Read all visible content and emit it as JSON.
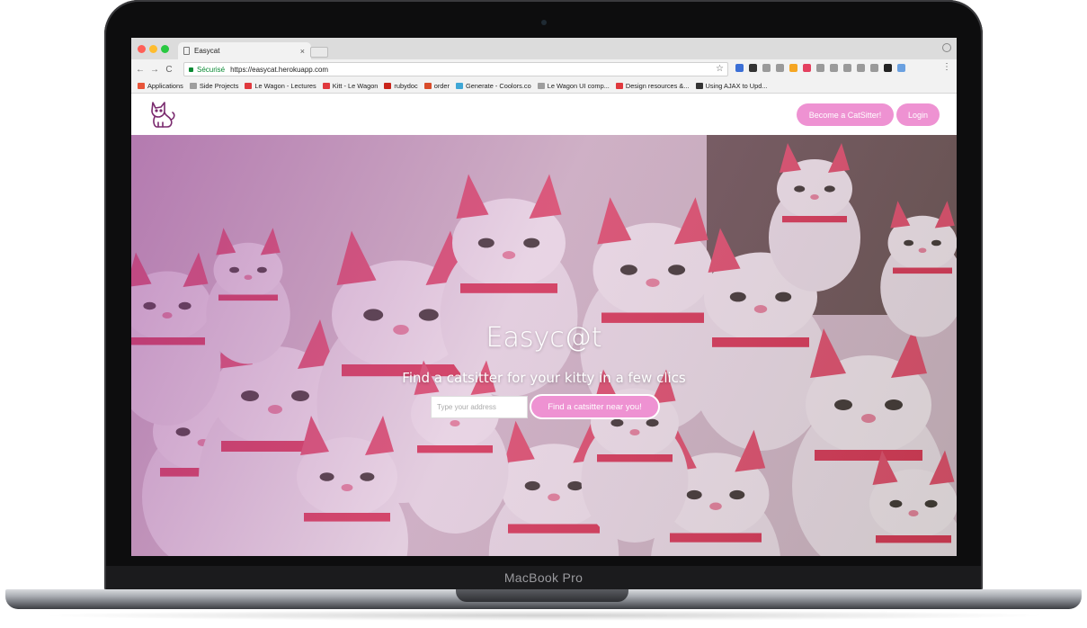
{
  "device": {
    "model_label": "MacBook Pro"
  },
  "browser": {
    "tab": {
      "title": "Easycat",
      "close": "×"
    },
    "toolbar": {
      "back": "←",
      "forward": "→",
      "reload": "C",
      "secure_label": "Sécurisé",
      "url": "https://easycat.herokuapp.com",
      "star": "☆",
      "menu": "⋮"
    },
    "bookmarks": [
      {
        "label": "Applications",
        "color": "#e8553a"
      },
      {
        "label": "Side Projects",
        "color": "#9e9e9e"
      },
      {
        "label": "Le Wagon - Lectures",
        "color": "#e0393e"
      },
      {
        "label": "Kitt - Le Wagon",
        "color": "#e0393e"
      },
      {
        "label": "rubydoc",
        "color": "#c9241b"
      },
      {
        "label": "order",
        "color": "#d94c2a"
      },
      {
        "label": "Generate - Coolors.co",
        "color": "#3fa7d6"
      },
      {
        "label": "Le Wagon UI comp...",
        "color": "#9e9e9e"
      },
      {
        "label": "Design resources &...",
        "color": "#e0393e"
      },
      {
        "label": "Using AJAX to Upd...",
        "color": "#333333"
      }
    ],
    "extension_colors": [
      "#3b6fd6",
      "#333333",
      "#9a9a9a",
      "#9a9a9a",
      "#f5a623",
      "#e4405f",
      "#9a9a9a",
      "#9a9a9a",
      "#9a9a9a",
      "#9a9a9a",
      "#9a9a9a",
      "#222222",
      "#6aa0e0"
    ]
  },
  "site": {
    "nav": {
      "logo_icon": "cat-logo-icon",
      "become_catsitter": "Become a CatSitter!",
      "login": "Login"
    },
    "hero": {
      "title": "Easyc@t",
      "subtitle": "Find a catsitter for your kitty in a few clics",
      "address_placeholder": "Type your address",
      "cta": "Find a catsitter near you!"
    }
  },
  "colors": {
    "accent_pink": "#ee92d2",
    "secure_green": "#0a8a34"
  }
}
